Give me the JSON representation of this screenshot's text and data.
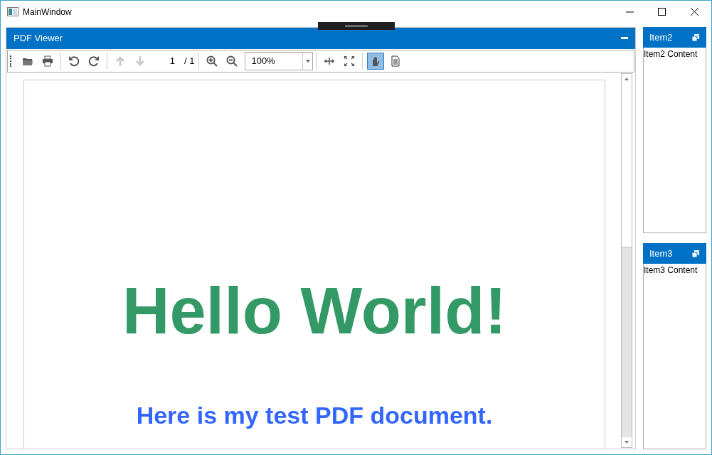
{
  "window": {
    "title": "MainWindow"
  },
  "pdf_panel": {
    "title": "PDF Viewer",
    "toolbar": [
      {
        "kind": "open",
        "disabled": false,
        "selected": false
      },
      {
        "kind": "print",
        "disabled": false,
        "selected": false
      },
      {
        "kind": "sep"
      },
      {
        "kind": "undo",
        "disabled": false,
        "selected": false
      },
      {
        "kind": "redo",
        "disabled": false,
        "selected": false
      },
      {
        "kind": "sep"
      },
      {
        "kind": "up",
        "disabled": true,
        "selected": false
      },
      {
        "kind": "down",
        "disabled": true,
        "selected": false
      },
      {
        "kind": "page",
        "value": "1",
        "total": "/ 1"
      },
      {
        "kind": "sep"
      },
      {
        "kind": "zoomin",
        "disabled": false,
        "selected": false
      },
      {
        "kind": "zoomout",
        "disabled": false,
        "selected": false
      },
      {
        "kind": "zoom",
        "value": "100%"
      },
      {
        "kind": "sep"
      },
      {
        "kind": "pan",
        "disabled": false,
        "selected": false
      },
      {
        "kind": "fit",
        "disabled": false,
        "selected": false
      },
      {
        "kind": "sep"
      },
      {
        "kind": "hand",
        "disabled": false,
        "selected": true
      },
      {
        "kind": "textselect",
        "disabled": false,
        "selected": false
      }
    ],
    "document": {
      "heading": "Hello World!",
      "subtitle": "Here is my test PDF document."
    }
  },
  "side_panels": [
    {
      "title": "Item2",
      "content": "Item2 Content"
    },
    {
      "title": "Item3",
      "content": "Item3 Content"
    }
  ]
}
